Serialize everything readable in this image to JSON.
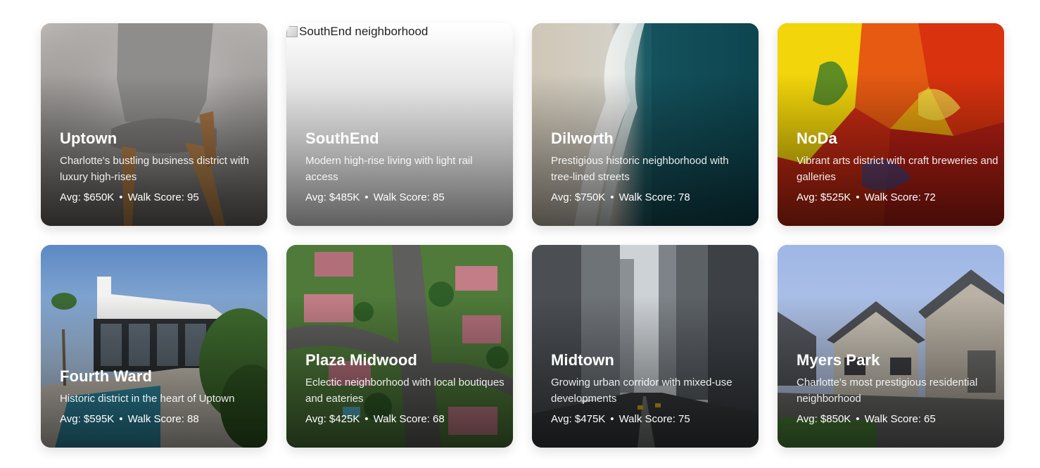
{
  "neighborhoods": [
    {
      "name": "Uptown",
      "description": "Charlotte's bustling business district with luxury high-rises",
      "avg_price": "Avg: $650K",
      "walk_score": "Walk Score: 95",
      "image": "chair-photo"
    },
    {
      "name": "SouthEnd",
      "description": "Modern high-rise living with light rail access",
      "avg_price": "Avg: $485K",
      "walk_score": "Walk Score: 85",
      "image": "broken-image",
      "image_alt": "SouthEnd neighborhood"
    },
    {
      "name": "Dilworth",
      "description": "Prestigious historic neighborhood with tree-lined streets",
      "avg_price": "Avg: $750K",
      "walk_score": "Walk Score: 78",
      "image": "ocean-shore-photo"
    },
    {
      "name": "NoDa",
      "description": "Vibrant arts district with craft breweries and galleries",
      "avg_price": "Avg: $525K",
      "walk_score": "Walk Score: 72",
      "image": "abstract-painting-photo"
    },
    {
      "name": "Fourth Ward",
      "description": "Historic district in the heart of Uptown",
      "avg_price": "Avg: $595K",
      "walk_score": "Walk Score: 88",
      "image": "modern-house-photo"
    },
    {
      "name": "Plaza Midwood",
      "description": "Eclectic neighborhood with local boutiques and eateries",
      "avg_price": "Avg: $425K",
      "walk_score": "Walk Score: 68",
      "image": "aerial-suburb-photo"
    },
    {
      "name": "Midtown",
      "description": "Growing urban corridor with mixed-use developments",
      "avg_price": "Avg: $475K",
      "walk_score": "Walk Score: 75",
      "image": "city-street-photo"
    },
    {
      "name": "Myers Park",
      "description": "Charlotte's most prestigious residential neighborhood",
      "avg_price": "Avg: $850K",
      "walk_score": "Walk Score: 65",
      "image": "suburban-homes-photo"
    }
  ],
  "separator": "•"
}
